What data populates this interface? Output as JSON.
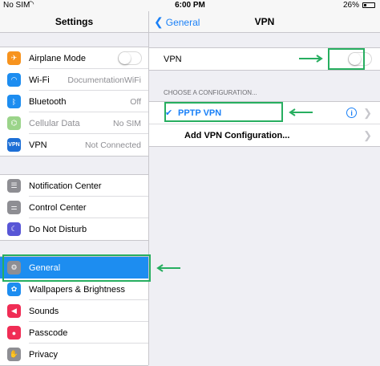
{
  "status_bar": {
    "carrier": "No SIM",
    "wifi_icon": "wifi-icon",
    "time": "6:00 PM",
    "battery": "26%"
  },
  "left": {
    "title": "Settings",
    "groups": [
      [
        {
          "label": "Airplane Mode",
          "icon": "airplane-icon",
          "color": "#f7931e",
          "toggle": false
        },
        {
          "label": "Wi-Fi",
          "icon": "wifi-icon",
          "color": "#1d8df0",
          "value": "DocumentationWiFi"
        },
        {
          "label": "Bluetooth",
          "icon": "bluetooth-icon",
          "color": "#1d8df0",
          "value": "Off"
        },
        {
          "label": "Cellular Data",
          "icon": "cellular-icon",
          "color": "#9bd48a",
          "value": "No SIM",
          "dim": true
        },
        {
          "label": "VPN",
          "icon": "vpn-icon",
          "color": "#1d6fd6",
          "value": "Not Connected"
        }
      ],
      [
        {
          "label": "Notification Center",
          "icon": "notification-center-icon",
          "color": "#8e8e93"
        },
        {
          "label": "Control Center",
          "icon": "control-center-icon",
          "color": "#8e8e93"
        },
        {
          "label": "Do Not Disturb",
          "icon": "moon-icon",
          "color": "#5856d6"
        }
      ],
      [
        {
          "label": "General",
          "icon": "gear-icon",
          "color": "#8e8e93",
          "selected": true
        },
        {
          "label": "Wallpapers & Brightness",
          "icon": "wallpaper-icon",
          "color": "#1d8df0"
        },
        {
          "label": "Sounds",
          "icon": "speaker-icon",
          "color": "#f02d55"
        },
        {
          "label": "Passcode",
          "icon": "lock-icon",
          "color": "#f02d55"
        },
        {
          "label": "Privacy",
          "icon": "hand-icon",
          "color": "#8e8e93"
        }
      ]
    ]
  },
  "right": {
    "back_label": "General",
    "title": "VPN",
    "vpn_label": "VPN",
    "vpn_toggle": false,
    "section_header": "CHOOSE A CONFIGURATION...",
    "configs": [
      {
        "label": "PPTP VPN",
        "checked": true
      },
      {
        "label": "Add VPN Configuration..."
      }
    ]
  },
  "colors": {
    "accent": "#1a80f7",
    "highlight": "#27ae60",
    "selected_row": "#1d8df0"
  }
}
